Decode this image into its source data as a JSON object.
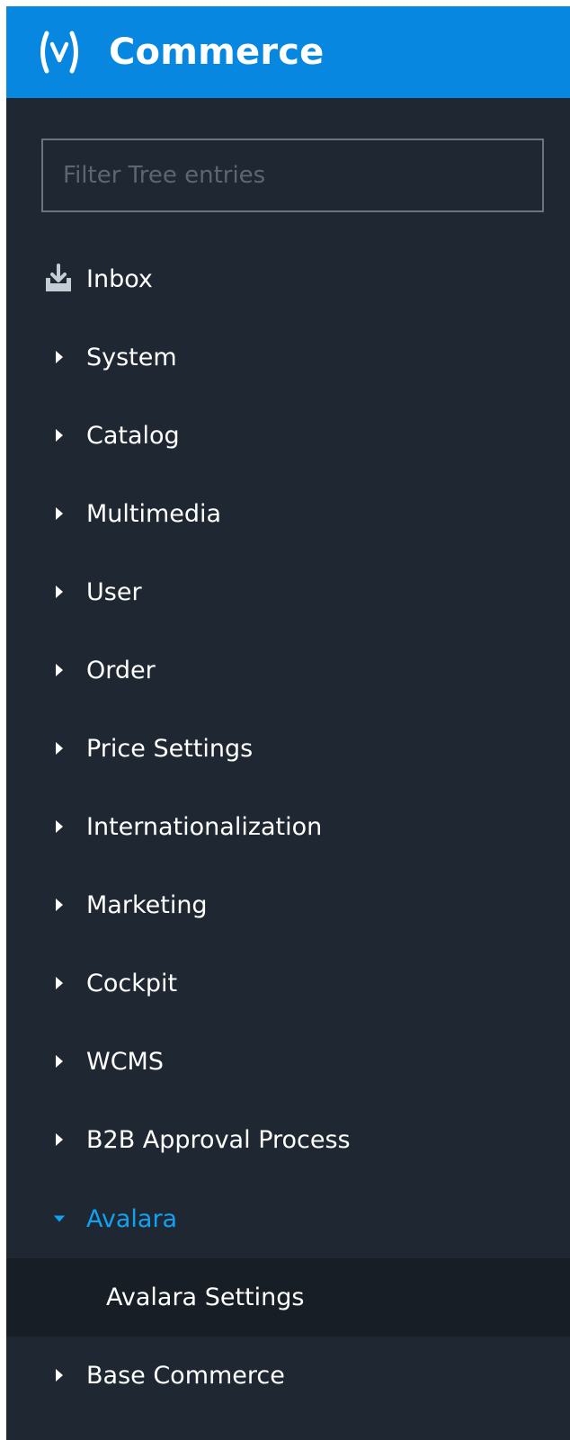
{
  "header": {
    "title": "Commerce",
    "logo_icon": "sap-bracket-logo",
    "background_color": "#0787e0"
  },
  "filter": {
    "placeholder": "Filter Tree entries",
    "value": ""
  },
  "inbox": {
    "label": "Inbox",
    "icon": "inbox-download-icon"
  },
  "tree": {
    "items": [
      {
        "label": "System",
        "expanded": false
      },
      {
        "label": "Catalog",
        "expanded": false
      },
      {
        "label": "Multimedia",
        "expanded": false
      },
      {
        "label": "User",
        "expanded": false
      },
      {
        "label": "Order",
        "expanded": false
      },
      {
        "label": "Price Settings",
        "expanded": false
      },
      {
        "label": "Internationalization",
        "expanded": false
      },
      {
        "label": "Marketing",
        "expanded": false
      },
      {
        "label": "Cockpit",
        "expanded": false
      },
      {
        "label": "WCMS",
        "expanded": false
      },
      {
        "label": "B2B Approval Process",
        "expanded": false
      },
      {
        "label": "Avalara",
        "expanded": true,
        "children": [
          {
            "label": "Avalara Settings",
            "selected": true
          }
        ]
      },
      {
        "label": "Base Commerce",
        "expanded": false
      }
    ]
  },
  "colors": {
    "panel_background": "#1f2832",
    "selected_row_background": "#171e26",
    "expanded_accent": "#11a1f0",
    "text": "#ffffff"
  }
}
